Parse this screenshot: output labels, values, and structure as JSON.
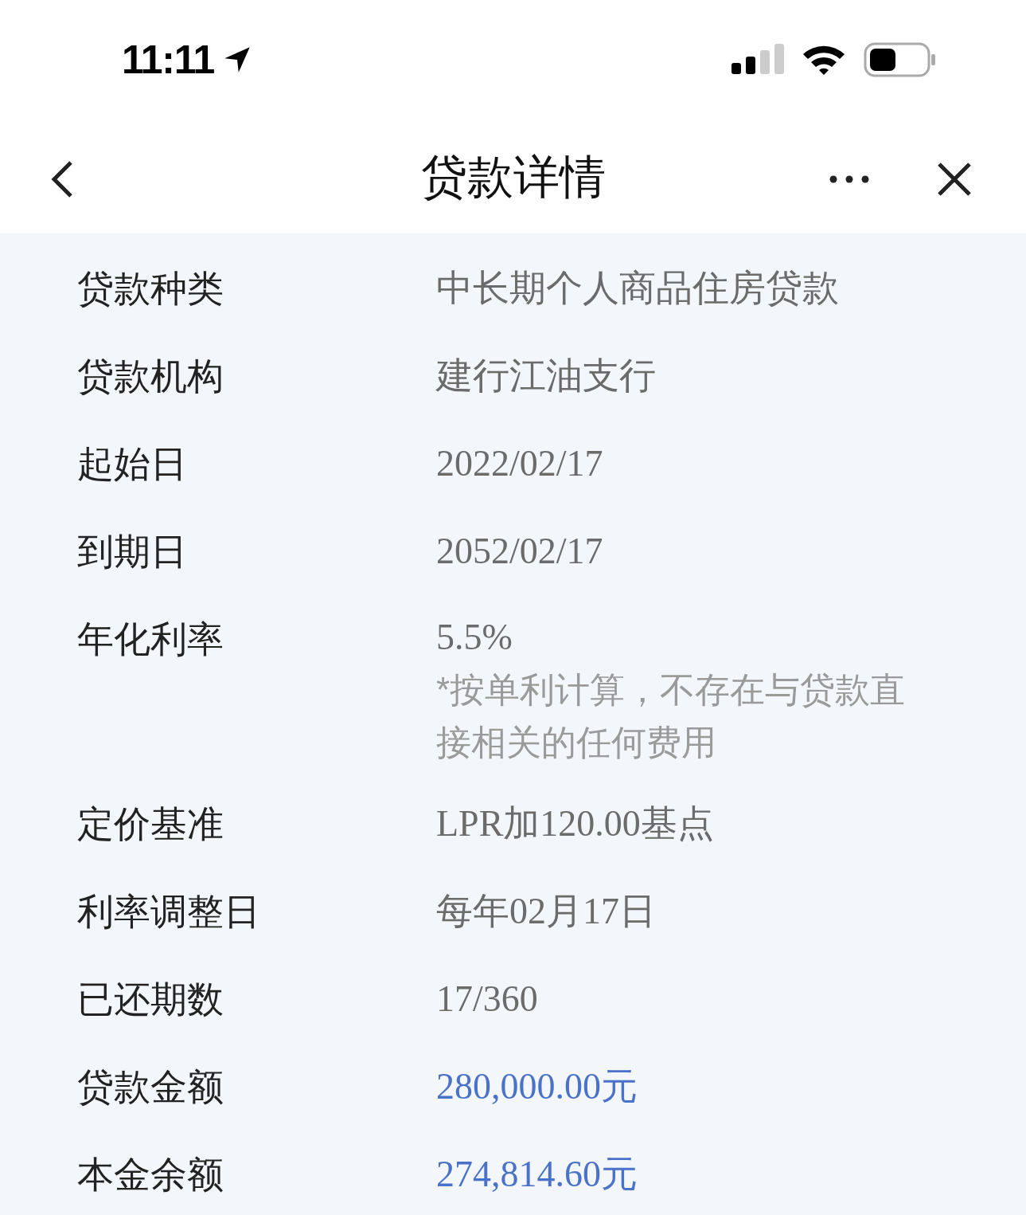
{
  "status_bar": {
    "time": "11:11"
  },
  "nav": {
    "title": "贷款详情"
  },
  "rows": [
    {
      "label": "贷款种类",
      "value": "中长期个人商品住房贷款",
      "highlight": false
    },
    {
      "label": "贷款机构",
      "value": "建行江油支行",
      "highlight": false
    },
    {
      "label": "起始日",
      "value": "2022/02/17",
      "highlight": false
    },
    {
      "label": "到期日",
      "value": "2052/02/17",
      "highlight": false
    },
    {
      "label": "年化利率",
      "value": "5.5%",
      "highlight": false,
      "note": "*按单利计算，不存在与贷款直接相关的任何费用"
    },
    {
      "label": "定价基准",
      "value": "LPR加120.00基点",
      "highlight": false
    },
    {
      "label": "利率调整日",
      "value": "每年02月17日",
      "highlight": false
    },
    {
      "label": "已还期数",
      "value": "17/360",
      "highlight": false
    },
    {
      "label": "贷款金额",
      "value": "280,000.00元",
      "highlight": true
    },
    {
      "label": "本金余额",
      "value": "274,814.60元",
      "highlight": true
    }
  ]
}
